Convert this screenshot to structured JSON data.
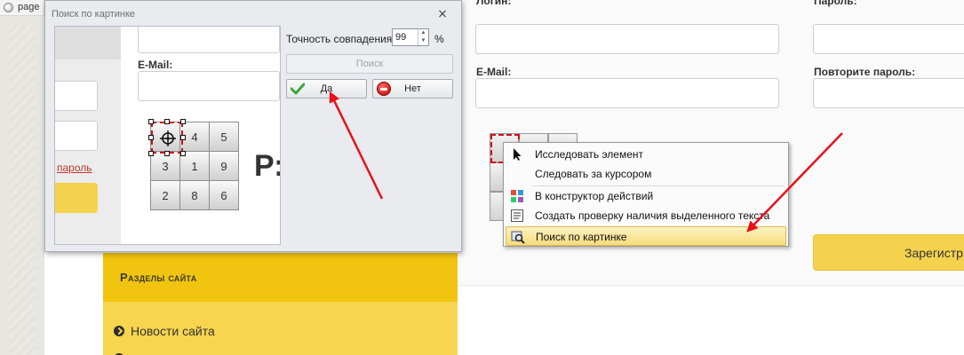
{
  "browser": {
    "tab_title": "page"
  },
  "page": {
    "login_label": "Логин:",
    "password_label": "Пароль:",
    "email_label": "E-Mail:",
    "repeat_password_label": "Повторите пароль:",
    "register_button": "Зарегистрироваться",
    "sidebar_header": "Разделы сайта",
    "sidebar_items": [
      "Новости сайта"
    ]
  },
  "dialog": {
    "title": "Поиск по картинке",
    "close_label": "⨯",
    "accuracy_label": "Точность совпадения:",
    "accuracy_value": "99",
    "percent_label": "%",
    "search_button": "Поиск",
    "yes_button": "Да",
    "no_button": "Нет",
    "preview": {
      "email_label": "E-Mail:",
      "link_text": "пароль",
      "big_char": "Р:",
      "keys": [
        "4",
        "5",
        "3",
        "1",
        "9",
        "2",
        "8",
        "6"
      ]
    }
  },
  "context_menu": {
    "items": [
      {
        "label": "Исследовать элемент",
        "icon": "cursor-icon"
      },
      {
        "label": "Следовать за курсором",
        "icon": "none"
      },
      {
        "label": "В конструктор действий",
        "icon": "constructor-icon"
      },
      {
        "label": "Создать проверку наличия выделенного текста",
        "icon": "text-check-icon"
      },
      {
        "label": "Поиск по картинке",
        "icon": "image-search-icon",
        "highlighted": true
      }
    ]
  },
  "colors": {
    "accent_yellow": "#f1c40f",
    "arrow_red": "#e8101a",
    "selection_red": "#d0111b"
  }
}
